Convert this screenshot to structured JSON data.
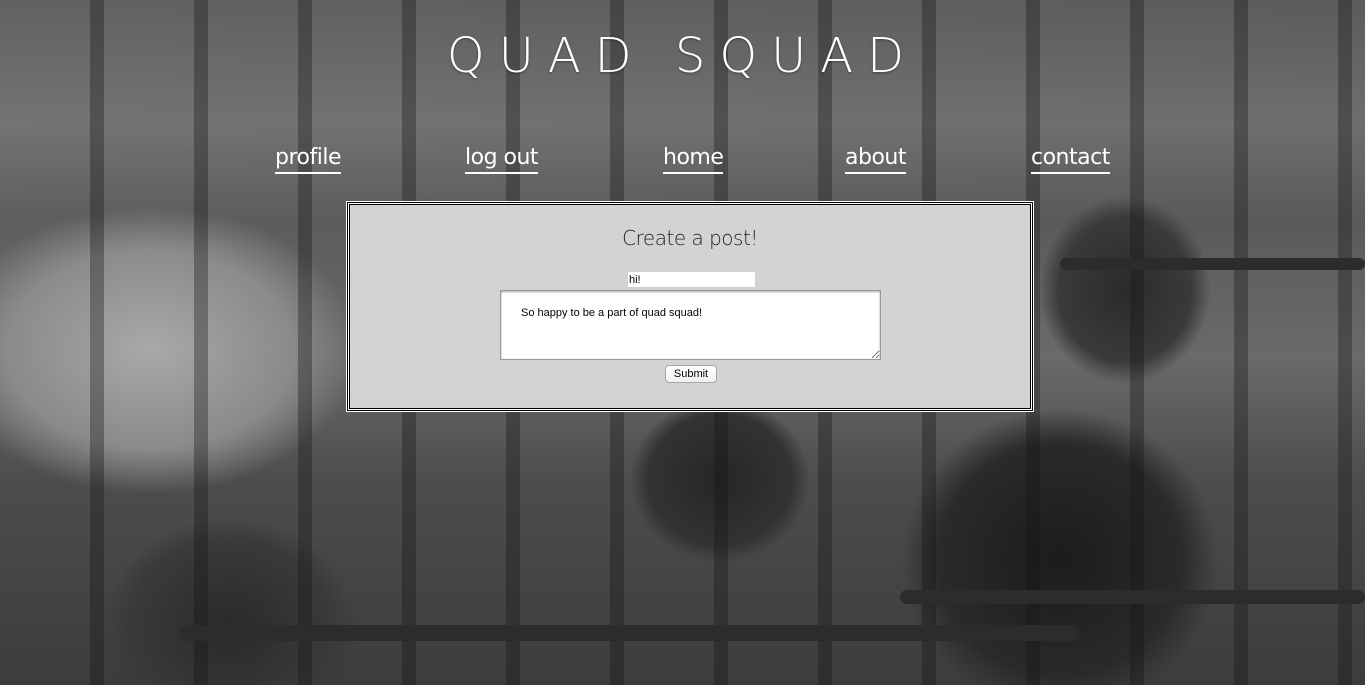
{
  "header": {
    "title": "QUAD SQUAD"
  },
  "nav": {
    "items": [
      {
        "label": "profile"
      },
      {
        "label": "log out"
      },
      {
        "label": "home"
      },
      {
        "label": "about"
      },
      {
        "label": "contact"
      }
    ]
  },
  "post_form": {
    "heading": "Create a post!",
    "title_value": "hi!",
    "body_value": "So happy to be a part of quad squad!",
    "submit_label": "Submit"
  },
  "colors": {
    "panel_background": "#d3d3d3",
    "nav_text": "#ffffff"
  },
  "icons": {
    "background": "gym-photo-background"
  }
}
